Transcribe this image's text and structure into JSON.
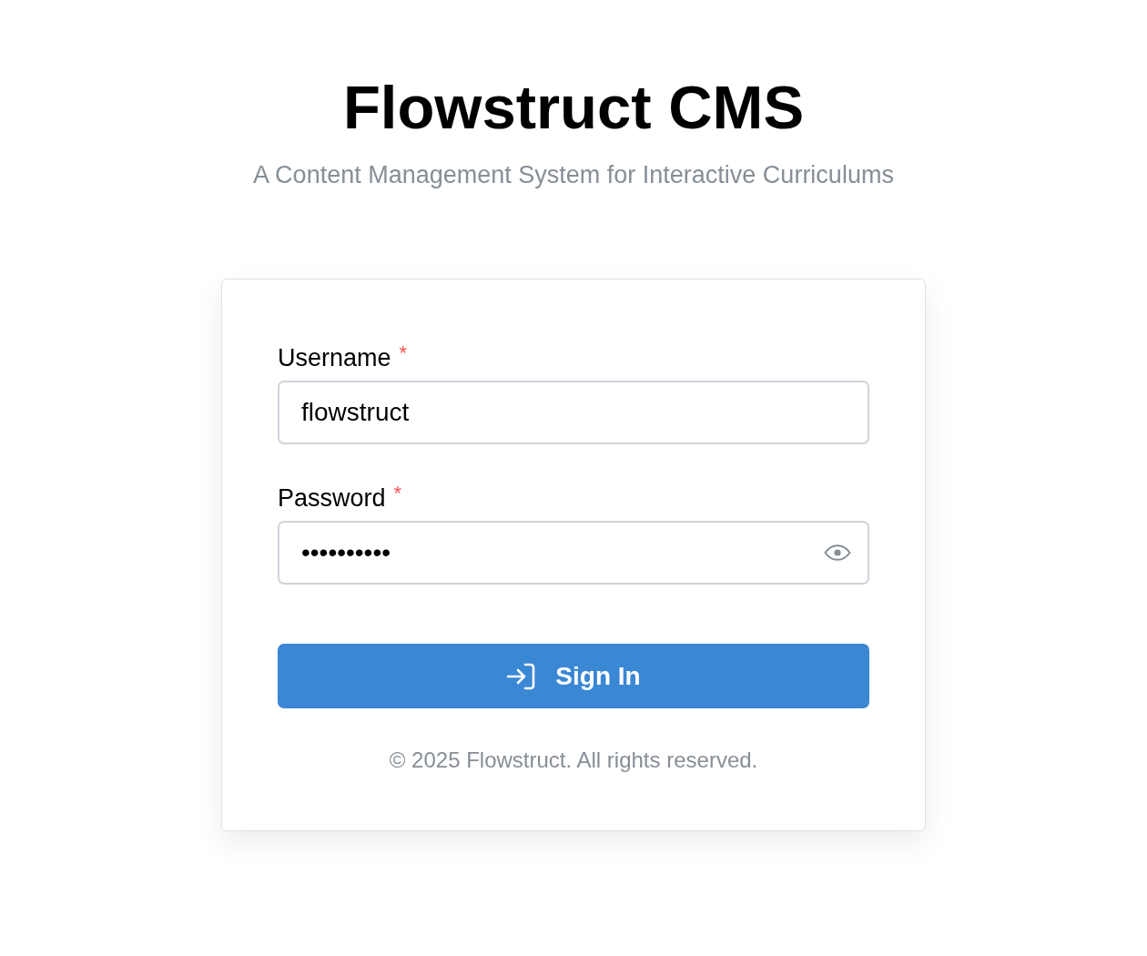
{
  "header": {
    "title": "Flowstruct CMS",
    "subtitle": "A Content Management System for Interactive Curriculums"
  },
  "form": {
    "fields": [
      {
        "kind": "text",
        "label": "Username",
        "required_mark": "*",
        "value": "flowstruct"
      },
      {
        "kind": "password",
        "label": "Password",
        "required_mark": "*",
        "value": "••••••••••"
      }
    ],
    "submit_button": {
      "label": "Sign In"
    },
    "footer": "© 2025 Flowstruct. All rights reserved."
  }
}
